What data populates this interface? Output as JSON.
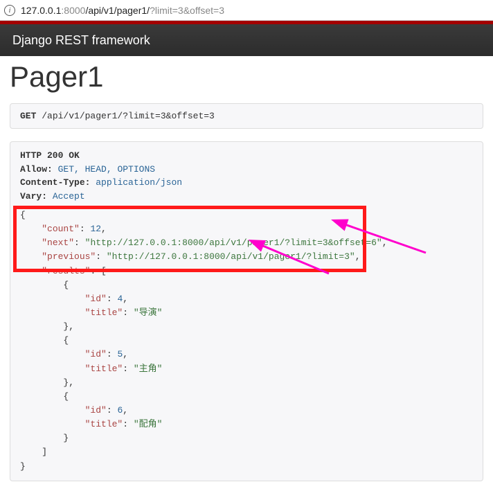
{
  "address": {
    "host": "127.0.0.1",
    "port": ":8000",
    "path": "/api/v1/pager1/",
    "query": "?limit=3&offset=3"
  },
  "navbar": {
    "brand": "Django REST framework"
  },
  "page": {
    "title": "Pager1"
  },
  "request": {
    "method": "GET",
    "path": "/api/v1/pager1/?limit=3&offset=3"
  },
  "response": {
    "status_line": "HTTP 200 OK",
    "headers": {
      "allow_label": "Allow:",
      "allow": "GET, HEAD, OPTIONS",
      "content_type_label": "Content-Type:",
      "content_type": "application/json",
      "vary_label": "Vary:",
      "vary": "Accept"
    },
    "body": {
      "count": 12,
      "next": "http://127.0.0.1:8000/api/v1/pager1/?limit=3&offset=6",
      "previous": "http://127.0.0.1:8000/api/v1/pager1/?limit=3",
      "results": [
        {
          "id": 4,
          "title": "导演"
        },
        {
          "id": 5,
          "title": "主角"
        },
        {
          "id": 6,
          "title": "配角"
        }
      ]
    },
    "keys": {
      "count": "\"count\"",
      "next": "\"next\"",
      "previous": "\"previous\"",
      "results": "\"results\"",
      "id": "\"id\"",
      "title": "\"title\""
    }
  }
}
